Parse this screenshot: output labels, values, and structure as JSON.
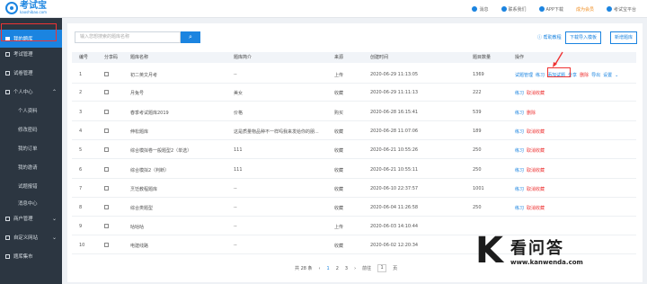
{
  "app": {
    "name": "考试宝",
    "domain": "kaoshibao.com"
  },
  "topnav": [
    {
      "label": "消息",
      "icon": "bell-icon"
    },
    {
      "label": "联系我们",
      "icon": "contact-icon"
    },
    {
      "label": "APP下载",
      "icon": "download-icon"
    },
    {
      "label": "成为会员",
      "icon": ""
    },
    {
      "label": "考试宝平台",
      "icon": "user-icon"
    }
  ],
  "sidebar": {
    "items": [
      {
        "label": "我的题库",
        "active": true
      },
      {
        "label": "考试管理"
      },
      {
        "label": "试卷管理"
      },
      {
        "label": "个人中心",
        "expanded": true
      },
      {
        "label": "个人资料",
        "sub": true
      },
      {
        "label": "修改密码",
        "sub": true
      },
      {
        "label": "我的订单",
        "sub": true
      },
      {
        "label": "我的邀请",
        "sub": true
      },
      {
        "label": "试题报错",
        "sub": true
      },
      {
        "label": "消息中心",
        "sub": true
      },
      {
        "label": "商户管理"
      },
      {
        "label": "自定义网站"
      },
      {
        "label": "题库集市"
      }
    ]
  },
  "search": {
    "placeholder": "输入您想搜索的题库名称"
  },
  "toolbar": {
    "help": "帮助教程",
    "download_template": "下载导入模板",
    "new_bank": "新增题库"
  },
  "table": {
    "headers": [
      "编号",
      "分享码",
      "题库名称",
      "题库简介",
      "来源",
      "创建时间",
      "题目数量",
      "操作"
    ],
    "rows": [
      {
        "no": "1",
        "name": "初二英文月考",
        "intro": "--",
        "source": "上传",
        "created": "2020-06-29 11:13:05",
        "count": "1369",
        "ops": [
          "试题管理",
          "练习",
          "添加试题",
          "分享",
          "删除",
          "导出",
          "设置"
        ]
      },
      {
        "no": "2",
        "name": "月兔号",
        "intro": "美女",
        "source": "收藏",
        "created": "2020-06-29 11:11:13",
        "count": "222",
        "ops": [
          "练习",
          "取消收藏"
        ]
      },
      {
        "no": "3",
        "name": "春季考试题库2019",
        "intro": "价格",
        "source": "购买",
        "created": "2020-06-28 16:15:41",
        "count": "539",
        "ops": [
          "练习",
          "删除"
        ]
      },
      {
        "no": "4",
        "name": "伸松题库",
        "intro": "这是质量物品种不一样吗我来发给你的朋...",
        "source": "收藏",
        "created": "2020-06-28 11:07:06",
        "count": "189",
        "ops": [
          "练习",
          "取消收藏"
        ]
      },
      {
        "no": "5",
        "name": "综合模拟卷一般题型2（单选）",
        "intro": "111",
        "source": "收藏",
        "created": "2020-06-21 10:55:26",
        "count": "250",
        "ops": [
          "练习",
          "取消收藏"
        ]
      },
      {
        "no": "6",
        "name": "综合模拟2（判断）",
        "intro": "111",
        "source": "收藏",
        "created": "2020-06-21 10:55:11",
        "count": "250",
        "ops": [
          "练习",
          "取消收藏"
        ]
      },
      {
        "no": "7",
        "name": "烹饪教程题库",
        "intro": "--",
        "source": "收藏",
        "created": "2020-06-10 22:37:57",
        "count": "1001",
        "ops": [
          "练习",
          "取消收藏"
        ]
      },
      {
        "no": "8",
        "name": "综合类题型",
        "intro": "--",
        "source": "收藏",
        "created": "2020-06-04 11:26:58",
        "count": "250",
        "ops": [
          "练习",
          "取消收藏"
        ]
      },
      {
        "no": "9",
        "name": "咕咕咕",
        "intro": "--",
        "source": "上传",
        "created": "2020-06-03 14:10:44",
        "count": "",
        "ops": []
      },
      {
        "no": "10",
        "name": "电建线路",
        "intro": "--",
        "source": "收藏",
        "created": "2020-06-02 12:20:34",
        "count": "",
        "ops": []
      }
    ]
  },
  "pager": {
    "total": "共 28 条",
    "pages": [
      "1",
      "2",
      "3"
    ],
    "current": "1",
    "goto": "前往",
    "goto_value": "1",
    "page_unit": "页"
  },
  "watermark": {
    "cn": "看问答",
    "url": "www.kanwenda.com"
  }
}
